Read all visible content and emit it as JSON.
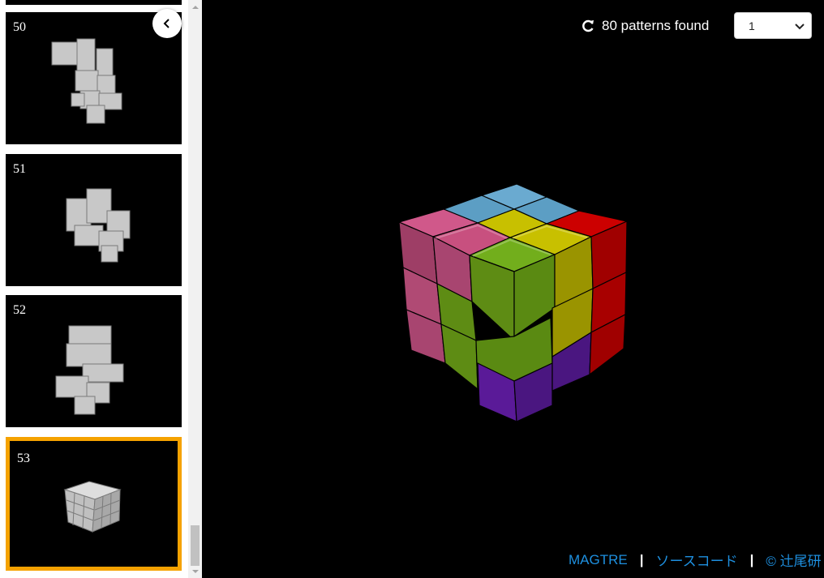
{
  "sidebar": {
    "thumbnails": [
      {
        "number": "50",
        "selected": false
      },
      {
        "number": "51",
        "selected": false
      },
      {
        "number": "52",
        "selected": false
      },
      {
        "number": "53",
        "selected": true
      }
    ],
    "collapse_icon": "chevron-left-icon"
  },
  "viewer": {
    "pattern_count_icon": "refresh-icon",
    "pattern_count": "80 patterns found",
    "pattern_select": {
      "value": "1"
    },
    "cube_colors": {
      "pink": "#c8507f",
      "blue": "#5c9ec4",
      "yellow": "#c8c000",
      "red": "#cc0000",
      "green": "#72ae1c",
      "purple": "#6020a8"
    }
  },
  "footer": {
    "link1": "MAGTRE",
    "link2": "ソースコード",
    "copyright": "© 辻尾研",
    "separator": "|"
  },
  "accent": "#f5a200"
}
